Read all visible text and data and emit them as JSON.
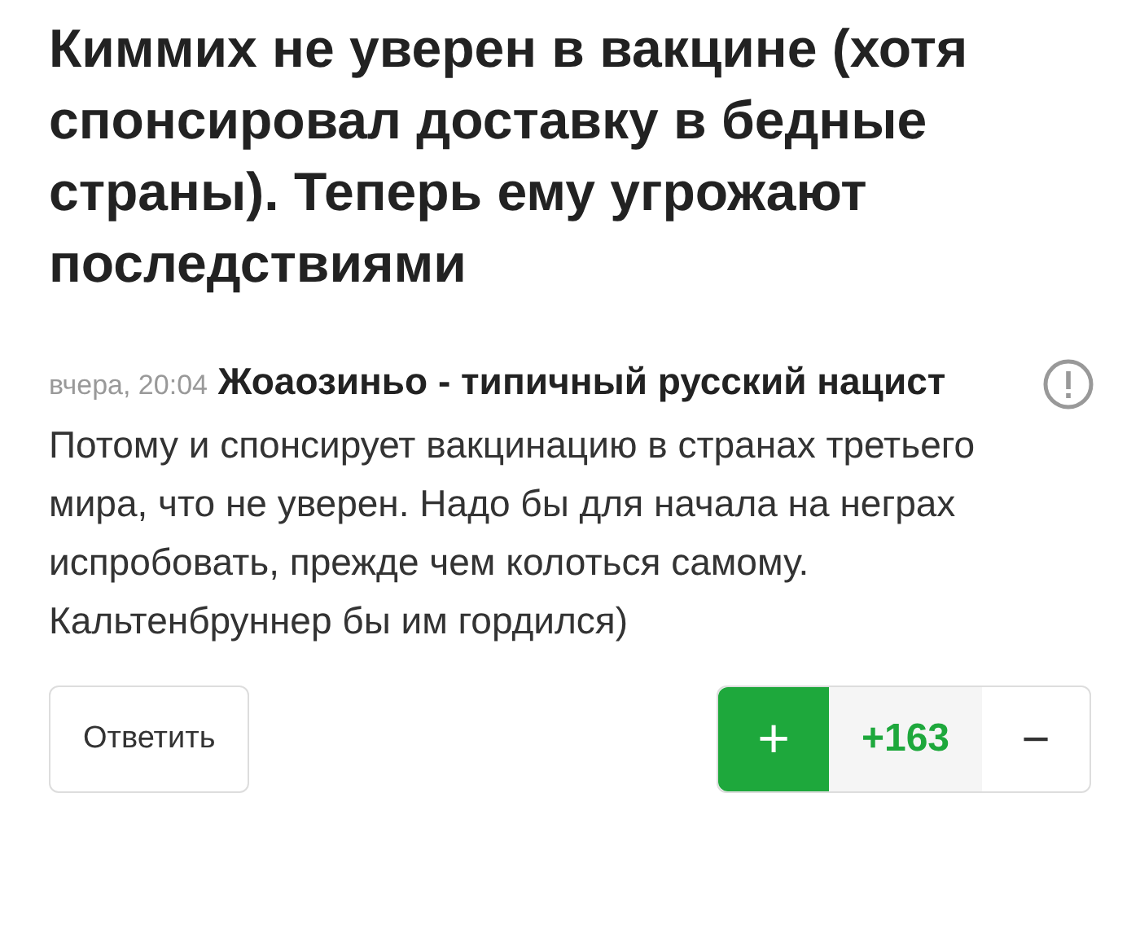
{
  "title": "Киммих не уверен в вакцине (хотя спонсировал доставку в бедные страны). Теперь ему угрожают последствиями",
  "comment": {
    "time": "вчера, 20:04",
    "author": "Жоаозиньо - типичный русский нацист",
    "text": "Потому и спонсирует вакцинацию в странах третьего мира, что не уверен. Надо бы для начала на неграх испробовать, прежде чем колоться самому. Кальтенбруннер бы им гордился)"
  },
  "actions": {
    "reply": "Ответить",
    "upvote": "+",
    "rating": "+163",
    "downvote": "−"
  }
}
